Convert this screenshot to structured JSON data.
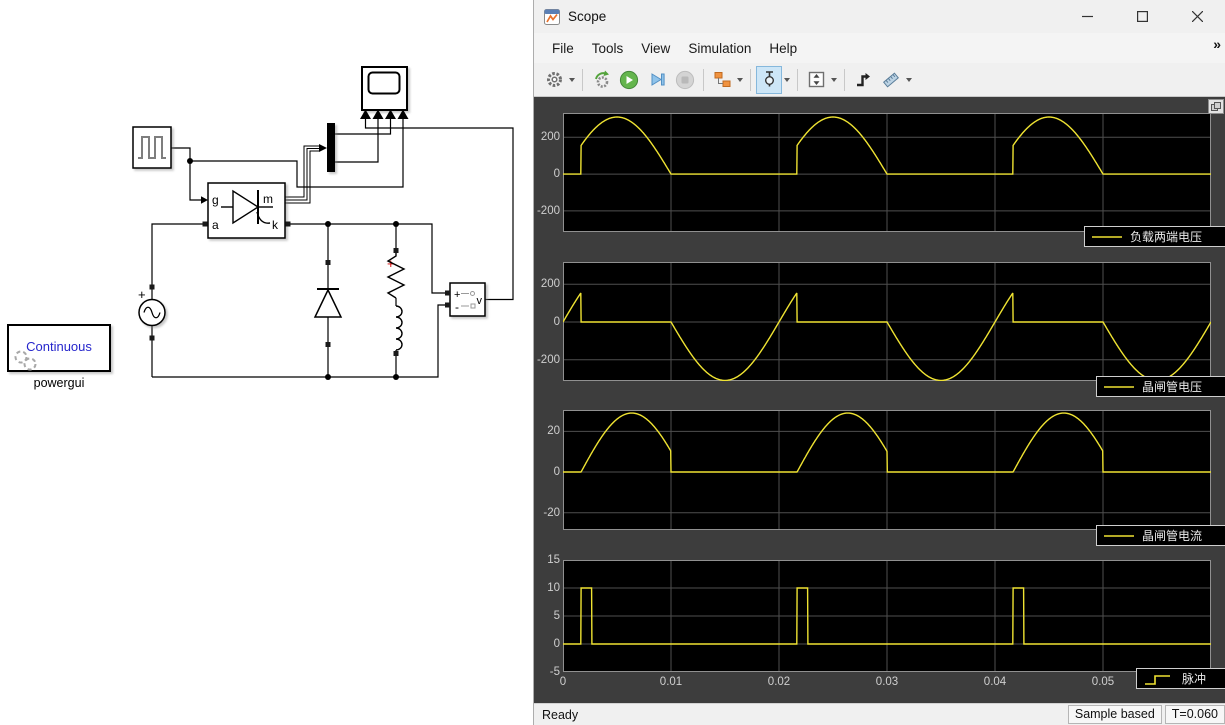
{
  "window": {
    "title": "Scope",
    "menus": [
      "File",
      "Tools",
      "View",
      "Simulation",
      "Help"
    ],
    "status": {
      "left": "Ready",
      "mode": "Sample based",
      "time": "T=0.060"
    }
  },
  "toolbar": {
    "icons": [
      "settings-gear",
      "run-with-stepping",
      "run",
      "step-forward",
      "stop",
      "highlight-simulink-block",
      "cursor-measurements",
      "span-axes",
      "trigger",
      "measurements-ruler"
    ]
  },
  "diagram": {
    "labels": {
      "gate": "g",
      "anode": "a",
      "measurement": "m",
      "cathode": "k",
      "source_plus": "+",
      "load_plus": "+",
      "vm_plus": "+",
      "vm_minus": "-",
      "vm_signal": "v",
      "powergui_mode": "Continuous",
      "powergui_name": "powergui"
    }
  },
  "chart_data": {
    "type": "line",
    "grid": true,
    "line_color": "#efe332",
    "x_axis": {
      "xlim": [
        0,
        0.06
      ],
      "xticks": [
        0,
        0.01,
        0.02,
        0.03,
        0.04,
        0.05
      ],
      "xtick_labels": [
        "0",
        "0.01",
        "0.02",
        "0.03",
        "0.04",
        "0.05"
      ]
    },
    "source_frequency_hz": 50,
    "period_s": 0.02,
    "firing_time_s": 0.00167,
    "firing_angle_deg": 30,
    "end_time_s": 0.06,
    "subplots": [
      {
        "legend": "负载两端电压",
        "kind": "load_voltage",
        "amplitude": 310,
        "ylim": [
          -315,
          332
        ],
        "yticks": [
          -200,
          0,
          200
        ],
        "legend_icon": "line"
      },
      {
        "legend": "晶闸管电压",
        "kind": "thyristor_voltage",
        "amplitude": 310,
        "ylim": [
          -313,
          318
        ],
        "yticks": [
          -200,
          0,
          200
        ],
        "legend_icon": "line"
      },
      {
        "legend": "晶闸管电流",
        "kind": "thyristor_current",
        "peak": 29,
        "conduction_shape_s": 0.0094,
        "ylim": [
          -28.5,
          30.5
        ],
        "yticks": [
          -20,
          0,
          20
        ],
        "legend_icon": "line"
      },
      {
        "legend": "脉冲",
        "kind": "pulse",
        "amplitude": 10,
        "pulse_width_s": 0.001,
        "ylim": [
          -5,
          15
        ],
        "yticks": [
          -5,
          0,
          5,
          10,
          15
        ],
        "legend_icon": "step",
        "show_xticklabels": true
      }
    ]
  }
}
